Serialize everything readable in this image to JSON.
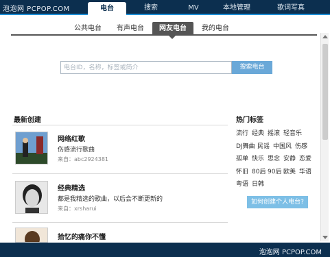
{
  "watermark_top": "泡泡网 PCPOP.COM",
  "nav": [
    {
      "label": "电台",
      "active": true
    },
    {
      "label": "搜索",
      "active": false
    },
    {
      "label": "MV",
      "active": false
    },
    {
      "label": "本地管理",
      "active": false
    },
    {
      "label": "歌词写真",
      "active": false
    }
  ],
  "subtabs": [
    {
      "label": "公共电台",
      "active": false
    },
    {
      "label": "有声电台",
      "active": false
    },
    {
      "label": "网友电台",
      "active": true
    },
    {
      "label": "我的电台",
      "active": false
    }
  ],
  "search": {
    "placeholder": "电台ID，名称，标签或简介",
    "button_label": "搜索电台"
  },
  "latest": {
    "title": "最新创建",
    "items": [
      {
        "title": "网络红歌",
        "desc": "伤感流行歌曲",
        "meta": "来自：abc2924381"
      },
      {
        "title": "经典精选",
        "desc": "都是我精选的歌曲，以后会不断更新的",
        "meta": "来自：xrsharui"
      },
      {
        "title": "拾忆的痛你不懂",
        "desc": "",
        "meta": ""
      }
    ]
  },
  "hot_tags": {
    "title": "热门标签",
    "rows": [
      [
        "流行",
        "经典",
        "摇滚",
        "轻音乐"
      ],
      [
        "DJ舞曲",
        "民谣",
        "中国风",
        "伤感"
      ],
      [
        "孤单",
        "快乐",
        "思念",
        "安静",
        "恋爱"
      ],
      [
        "怀旧",
        "80后",
        "90后",
        "欧美",
        "华语"
      ],
      [
        "粤语",
        "日韩"
      ]
    ],
    "help_button": "如何创建个人电台?"
  },
  "watermark_bottom": "泡泡网 PCPOP.COM",
  "colors": {
    "nav_bg": "#0c2f4f",
    "accent": "#1e8fd6",
    "search_button": "#6aa8d8",
    "help_button": "#7dbfe6"
  }
}
